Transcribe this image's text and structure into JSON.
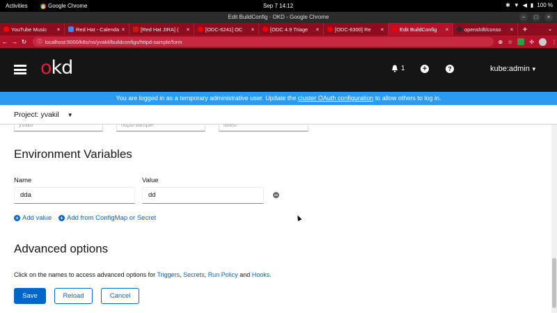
{
  "system_bar": {
    "activities": "Activities",
    "app_name": "Google Chrome",
    "clock": "Sep 7  14:12",
    "battery": "100 %"
  },
  "window": {
    "title": "Edit BuildConfig · OKD - Google Chrome"
  },
  "tabs": [
    {
      "label": "YouTube Music",
      "fav_color": "#ff0000"
    },
    {
      "label": "Red Hat - Calenda",
      "fav_color": "#4285f4"
    },
    {
      "label": "[Red Hat JIRA] (",
      "fav_color": "#c9190b"
    },
    {
      "label": "[ODC-6241] OC",
      "fav_color": "#ee0000"
    },
    {
      "label": "[ODC 4.9 Triage",
      "fav_color": "#ee0000"
    },
    {
      "label": "[ODC-6300] Re",
      "fav_color": "#ee0000"
    },
    {
      "label": "Edit BuildConfig",
      "fav_color": "#ee0000"
    },
    {
      "label": "openshift/conso",
      "fav_color": "#24292e"
    }
  ],
  "address_bar": {
    "url": "localhost:9000/k8s/ns/yvakil/buildconfigs/httpd-sample/form"
  },
  "masthead": {
    "logo_o": "o",
    "logo_kd": "kd",
    "notification_count": "1",
    "user": "kube:admin"
  },
  "banner": {
    "prefix": "You are logged in as a temporary administrative user. Update the ",
    "link": "cluster OAuth configuration",
    "suffix": " to allow others to log in."
  },
  "project": {
    "label": "Project: yvakil"
  },
  "prev_fields": [
    "yvakil",
    "httpd-sample",
    "latest"
  ],
  "env_section": {
    "title": "Environment Variables",
    "name_label": "Name",
    "value_label": "Value",
    "name_value": "dda",
    "value_value": "dd",
    "add_value": "Add value",
    "add_from": "Add from ConfigMap or Secret"
  },
  "advanced": {
    "title": "Advanced options",
    "desc_prefix": "Click on the names to access advanced options for ",
    "triggers": "Triggers",
    "sep1": ", ",
    "secrets": "Secrets",
    "sep2": ", ",
    "run_policy": "Run Policy",
    "and": " and ",
    "hooks": "Hooks",
    "period": "."
  },
  "actions": {
    "save": "Save",
    "reload": "Reload",
    "cancel": "Cancel"
  },
  "colors": {
    "primary": "#0066cc",
    "brand_red": "#e0203c",
    "banner_blue": "#2b9af3",
    "masthead": "#151515"
  }
}
